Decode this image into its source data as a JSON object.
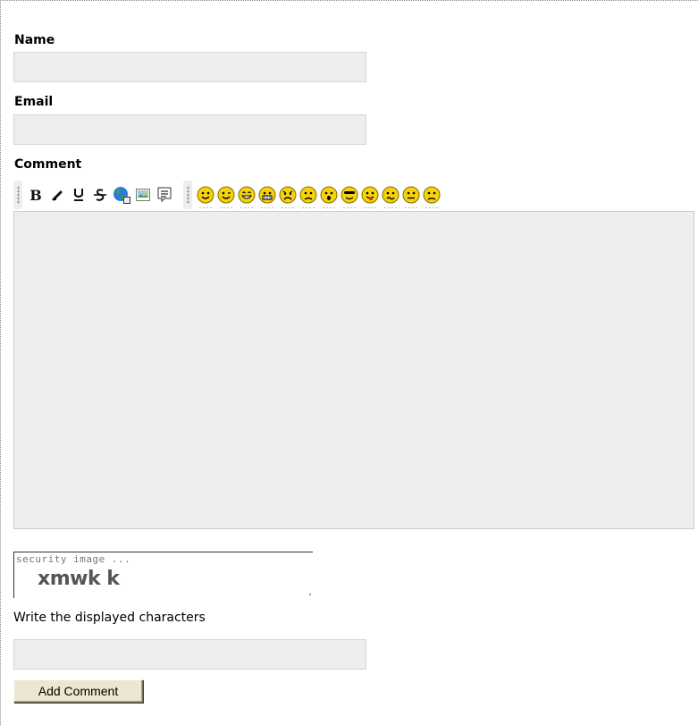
{
  "form": {
    "name_label": "Name",
    "name_value": "",
    "email_label": "Email",
    "email_value": "",
    "comment_label": "Comment",
    "comment_value": "",
    "captcha_header": "security image ...",
    "captcha_code": "xmwk k",
    "captcha_instruction": "Write the displayed characters",
    "captcha_value": "",
    "submit_label": "Add Comment"
  },
  "toolbar": {
    "format_buttons": [
      {
        "icon": "bold-icon",
        "glyph": "B"
      },
      {
        "icon": "italic-icon",
        "glyph": "/"
      },
      {
        "icon": "underline-icon",
        "glyph": "U"
      },
      {
        "icon": "strikethrough-icon",
        "glyph": "S"
      },
      {
        "icon": "insert-link-icon"
      },
      {
        "icon": "insert-image-icon"
      },
      {
        "icon": "insert-quote-icon"
      }
    ],
    "smileys": [
      "smile",
      "wink",
      "happy",
      "grin",
      "angry",
      "sad",
      "surprised",
      "cool",
      "tongue",
      "confused",
      "neutral",
      "frown"
    ],
    "colors": {
      "smiley_fill": "#f4d20c",
      "smiley_stroke": "#8a6a00",
      "field_bg": "#eeeeee"
    }
  }
}
